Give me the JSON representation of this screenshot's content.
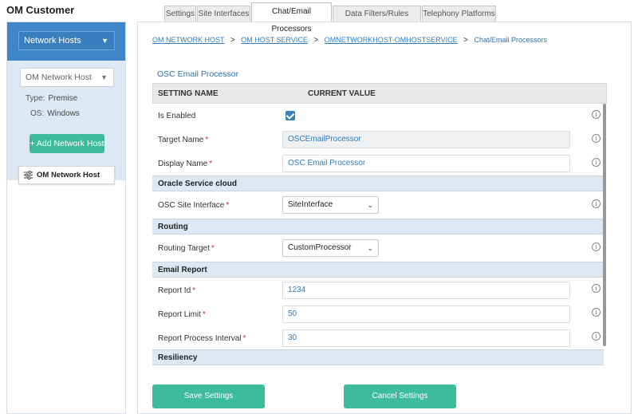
{
  "app": {
    "title": "OM Customer"
  },
  "sidebar": {
    "network_hosts_select": "Network Hosts",
    "host_select": "OM Network Host",
    "type_label": "Type:",
    "type_value": "Premise",
    "os_label": "OS:",
    "os_value": "Windows",
    "add_button": "+ Add Network Host",
    "host_card": "OM Network Host"
  },
  "tabs": [
    {
      "label": "Settings"
    },
    {
      "label": "Site Interfaces"
    },
    {
      "label": "Chat/Email Processors",
      "active": true
    },
    {
      "label": "Data Filters/Rules Engine"
    },
    {
      "label": "Telephony Platforms"
    }
  ],
  "breadcrumb": {
    "items": [
      "OM NETWORK HOST",
      "OM HOST SERVICE",
      "OMNETWORKHOST-OMHOSTSERVICE",
      "Chat/Email Processors"
    ],
    "separator": ">"
  },
  "section_title": "OSC Email Processor",
  "grid": {
    "col_setting": "SETTING NAME",
    "col_value": "CURRENT VALUE",
    "is_enabled": {
      "label": "Is Enabled",
      "checked": true
    },
    "target_name": {
      "label": "Target Name",
      "value": "OSCEmailProcessor"
    },
    "display_name": {
      "label": "Display Name",
      "value": "OSC Email Processor"
    },
    "sec_oracle": "Oracle Service cloud",
    "osc_site_interface": {
      "label": "OSC Site Interface",
      "value": "SiteInterface"
    },
    "sec_routing": "Routing",
    "routing_target": {
      "label": "Routing Target",
      "value": "CustomProcessor"
    },
    "sec_email_report": "Email Report",
    "report_id": {
      "label": "Report Id",
      "value": "1234"
    },
    "report_limit": {
      "label": "Report Limit",
      "value": "50"
    },
    "report_interval": {
      "label": "Report Process Interval",
      "value": "30"
    },
    "sec_resiliency": "Resiliency",
    "required_mark": "*",
    "info_glyph": "i"
  },
  "buttons": {
    "save": "Save Settings",
    "cancel": "Cancel Settings"
  },
  "icons": {
    "chevron": "chevron-down-icon",
    "info": "info-icon",
    "sliders": "sliders-icon",
    "check": "check-icon"
  },
  "colors": {
    "primary_blue": "#3f86c8",
    "accent_green": "#3dbb9a",
    "link_blue": "#2f7bc0",
    "section_bg": "#dde8f2"
  }
}
